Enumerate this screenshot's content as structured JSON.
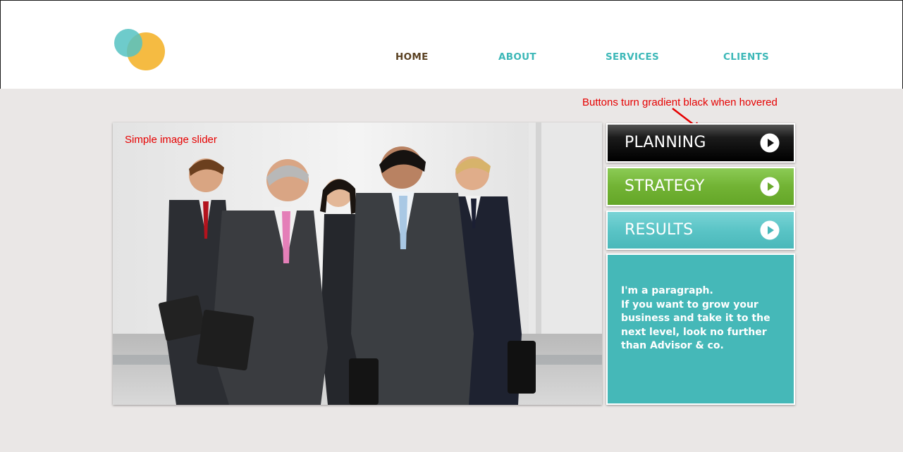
{
  "nav": {
    "items": [
      {
        "label": "HOME",
        "active": true
      },
      {
        "label": "ABOUT",
        "active": false
      },
      {
        "label": "SERVICES",
        "active": false
      },
      {
        "label": "CLIENTS",
        "active": false
      }
    ]
  },
  "annotations": {
    "hover_note": "Buttons turn gradient black when hovered",
    "slider_note": "Simple image slider"
  },
  "buttons": [
    {
      "label": "PLANNING"
    },
    {
      "label": "STRATEGY"
    },
    {
      "label": "RESULTS"
    }
  ],
  "info": {
    "line1": "I'm a paragraph.",
    "line2": "If you want to grow your business and take it to the next level, look no further than Advisor & co."
  },
  "colors": {
    "accent_teal": "#3db8b8",
    "nav_active": "#5a4122",
    "logo_yellow": "#f5bb42",
    "logo_teal": "#55c2c2",
    "strategy_green": "#72b334",
    "results_teal": "#5ac4c6",
    "annotation_red": "#e60000"
  }
}
